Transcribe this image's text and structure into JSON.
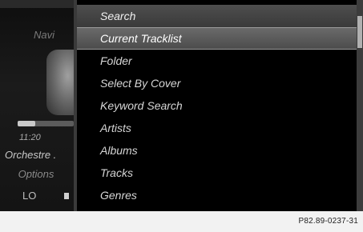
{
  "side_panel": {
    "nav_label": "Navi",
    "progress_fraction": 0.32,
    "time": "11:20",
    "track_title": "Orchestre .",
    "options_label": "Options",
    "lo_label": "LO"
  },
  "menu": {
    "items": [
      {
        "label": "Search"
      },
      {
        "label": "Current Tracklist",
        "selected": true
      },
      {
        "label": "Folder"
      },
      {
        "label": "Select By Cover"
      },
      {
        "label": "Keyword Search"
      },
      {
        "label": "Artists"
      },
      {
        "label": "Albums"
      },
      {
        "label": "Tracks"
      },
      {
        "label": "Genres"
      }
    ]
  },
  "caption": "P82.89-0237-31"
}
